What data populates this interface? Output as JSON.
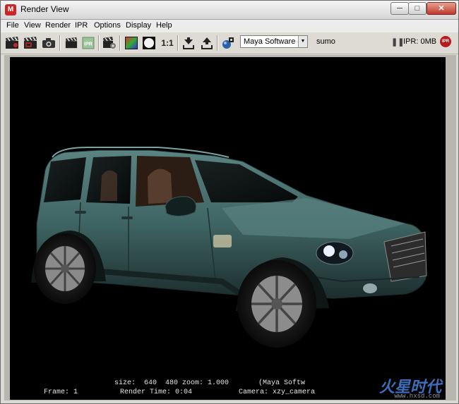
{
  "window": {
    "title": "Render View"
  },
  "menubar": {
    "items": [
      "File",
      "View",
      "Render",
      "IPR",
      "Options",
      "Display",
      "Help"
    ]
  },
  "toolbar": {
    "ratio_label": "1:1",
    "renderer_select": {
      "value": "Maya Software"
    },
    "camera_label": "sumo",
    "ipr_memory": "IPR: 0MB",
    "ipr_badge": "IPR"
  },
  "render_info": {
    "size_line": "size:  640  480 zoom: 1.000       (Maya Softw",
    "frame": "Frame: 1",
    "render_time": "Render Time: 0:04",
    "camera": "Camera: xzy_camera"
  },
  "watermark": {
    "text": "火星时代",
    "url": "www.hxsd.com"
  },
  "colors": {
    "car_body": "#3e6463",
    "background": "#000000"
  }
}
